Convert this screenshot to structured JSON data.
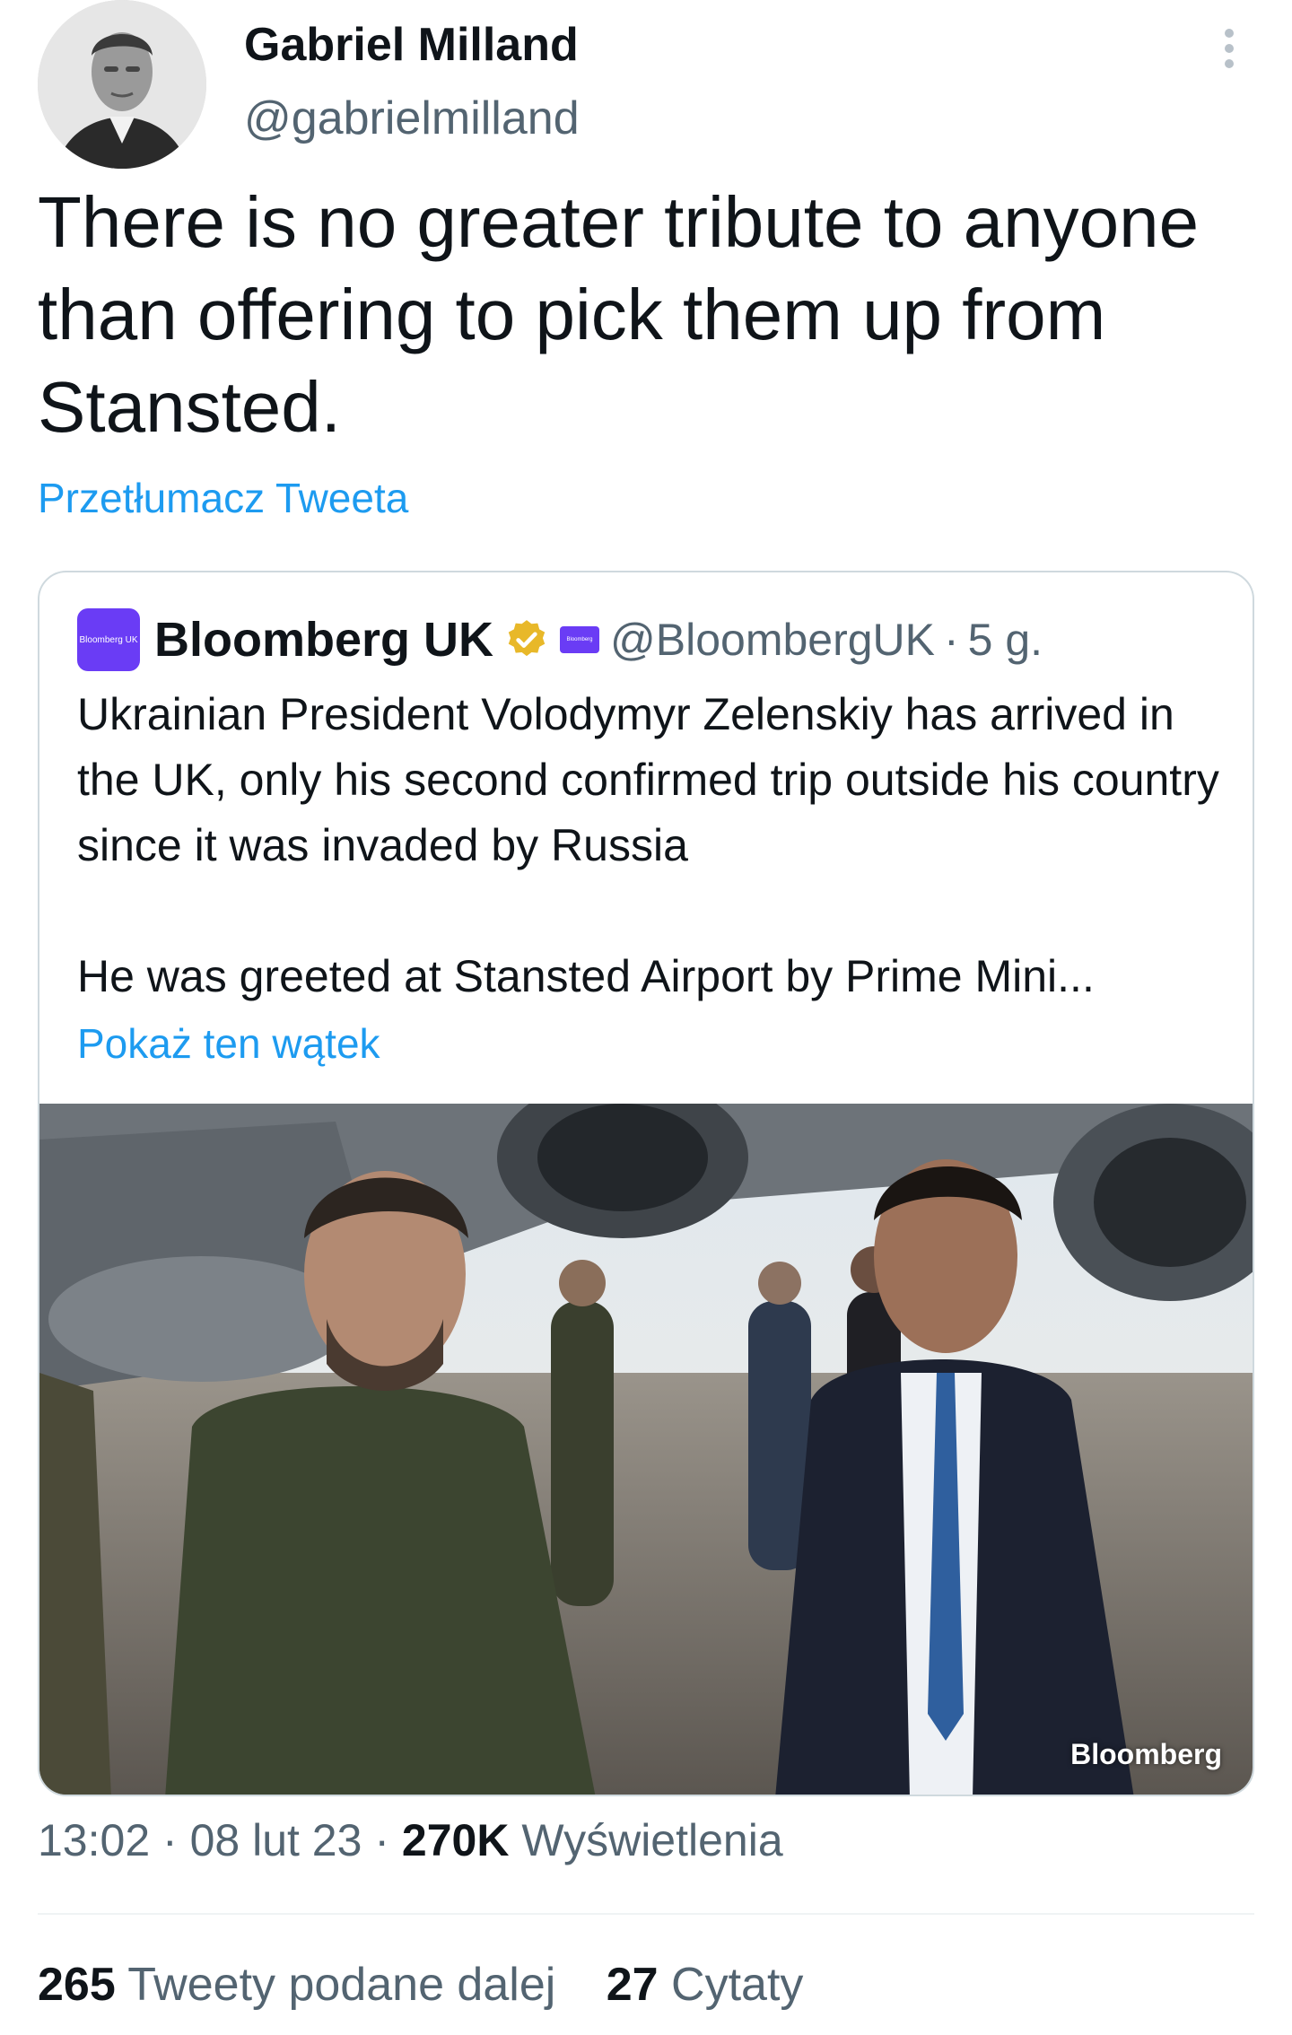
{
  "author": {
    "name": "Gabriel Milland",
    "handle": "@gabrielmilland"
  },
  "tweet": {
    "text": "There is no greater tribute to anyone than offering to pick them up from Stansted.",
    "translate_label": "Przetłumacz Tweeta"
  },
  "quoted": {
    "avatar_text": "Bloomberg UK",
    "name": "Bloomberg UK",
    "affiliate_badge_text": "Bloomberg",
    "handle": "@BloombergUK",
    "separator": "·",
    "time": "5 g.",
    "text_p1": "Ukrainian President Volodymyr Zelenskiy has arrived in the UK, only his second confirmed trip outside his country since it was invaded by Russia",
    "text_p2": "He was greeted at Stansted Airport by Prime Mini...",
    "show_thread": "Pokaż ten wątek",
    "photo_watermark": "Bloomberg"
  },
  "meta": {
    "time": "13:02",
    "sep1": "·",
    "date": "08 lut 23",
    "sep2": "·",
    "views_count": "270K",
    "views_label": "Wyświetlenia"
  },
  "stats": {
    "retweets_count": "265",
    "retweets_label": "Tweety podane dalej",
    "quotes_count": "27",
    "quotes_label": "Cytaty"
  },
  "colors": {
    "link": "#1d9bf0",
    "secondary_text": "#536471",
    "primary_text": "#0f1419",
    "brand_purple": "#6a3cf5",
    "verified_gold": "#e8b829"
  }
}
